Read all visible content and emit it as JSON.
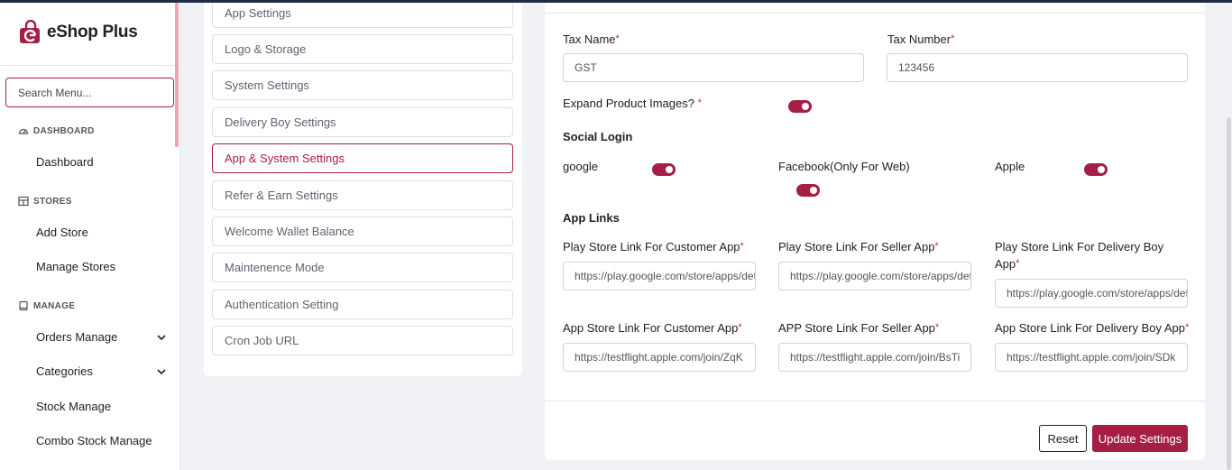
{
  "brand": {
    "name": "eShop Plus",
    "accent": "#a51f45"
  },
  "sidebar": {
    "search_placeholder": "Search Menu...",
    "sections": {
      "dashboard": {
        "label": "DASHBOARD",
        "icon": "dashboard-icon"
      },
      "stores": {
        "label": "STORES",
        "icon": "store-icon"
      },
      "manage": {
        "label": "MANAGE",
        "icon": "book-icon"
      }
    },
    "items": {
      "dashboard": "Dashboard",
      "add_store": "Add Store",
      "manage_stores": "Manage Stores",
      "orders_manage": "Orders Manage",
      "categories": "Categories",
      "stock_manage": "Stock Manage",
      "combo_stock_manage": "Combo Stock Manage"
    }
  },
  "settings_menu": {
    "items": [
      "App Settings",
      "Logo & Storage",
      "System Settings",
      "Delivery Boy Settings",
      "App & System Settings",
      "Refer & Earn Settings",
      "Welcome Wallet Balance",
      "Maintenence Mode",
      "Authentication Setting",
      "Cron Job URL"
    ],
    "active": "App & System Settings"
  },
  "form": {
    "tax_name": {
      "label": "Tax Name",
      "value": "GST"
    },
    "tax_number": {
      "label": "Tax Number",
      "value": "123456"
    },
    "expand_images": {
      "label": "Expand Product Images? ",
      "enabled": true
    },
    "social_login": {
      "heading": "Social Login",
      "google": {
        "label": "google",
        "enabled": true
      },
      "facebook": {
        "label": "Facebook(Only For Web)",
        "enabled": true
      },
      "apple": {
        "label": "Apple",
        "enabled": true
      }
    },
    "app_links": {
      "heading": "App Links",
      "play_customer": {
        "label": "Play Store Link For Customer App",
        "value": "https://play.google.com/store/apps/details?id="
      },
      "play_seller": {
        "label": "Play Store Link For Seller App",
        "value": "https://play.google.com/store/apps/details?id="
      },
      "play_delivery": {
        "label": "Play Store Link For Delivery Boy App",
        "value": "https://play.google.com/store/apps/details?id="
      },
      "appstore_customer": {
        "label": "App Store Link For Customer App",
        "value": "https://testflight.apple.com/join/ZqK"
      },
      "appstore_seller": {
        "label": "APP Store Link For Seller App",
        "value": "https://testflight.apple.com/join/BsTi"
      },
      "appstore_delivery": {
        "label": "App Store Link For Delivery Boy App",
        "value": "https://testflight.apple.com/join/SDk"
      }
    },
    "reset_label": "Reset",
    "update_label": "Update Settings"
  }
}
